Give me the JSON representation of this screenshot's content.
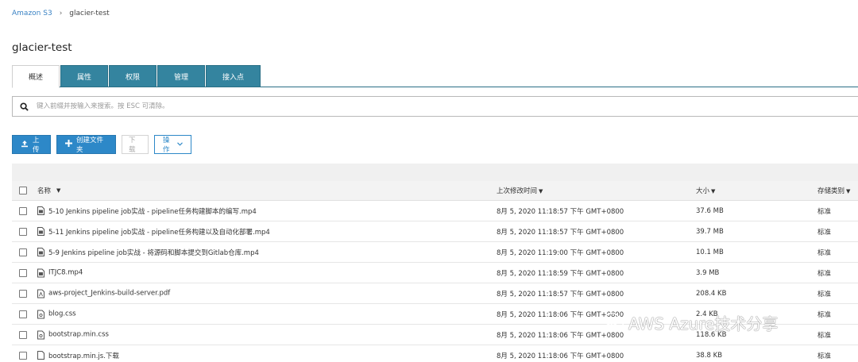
{
  "breadcrumb": {
    "root": "Amazon S3",
    "separator": "›",
    "current": "glacier-test"
  },
  "bucket": {
    "title": "glacier-test"
  },
  "tabs": [
    {
      "label": "概述",
      "active": true
    },
    {
      "label": "属性",
      "active": false
    },
    {
      "label": "权限",
      "active": false
    },
    {
      "label": "管理",
      "active": false
    },
    {
      "label": "接入点",
      "active": false
    }
  ],
  "search": {
    "placeholder": "键入前缀并按输入来搜索。按 ESC 可清除。",
    "value": ""
  },
  "toolbar": {
    "upload_label": "上传",
    "create_folder_label": "创建文件夹",
    "download_label": "下载",
    "actions_label": "操作"
  },
  "table": {
    "headers": {
      "name": "名称",
      "modified": "上次修改时间",
      "size": "大小",
      "storage_class": "存储类别"
    },
    "rows": [
      {
        "name": "5-10 Jenkins pipeline job实战 - pipeline任务构建脚本的编写.mp4",
        "icon": "video-file-icon",
        "modified": "8月 5, 2020 11:18:57 下午 GMT+0800",
        "size": "37.6 MB",
        "storage_class": "标准"
      },
      {
        "name": "5-11 Jenkins pipeline job实战 - pipeline任务构建以及自动化部署.mp4",
        "icon": "video-file-icon",
        "modified": "8月 5, 2020 11:18:57 下午 GMT+0800",
        "size": "39.7 MB",
        "storage_class": "标准"
      },
      {
        "name": "5-9 Jenkins pipeline job实战 - 将源码和脚本提交到Gitlab仓库.mp4",
        "icon": "video-file-icon",
        "modified": "8月 5, 2020 11:19:00 下午 GMT+0800",
        "size": "10.1 MB",
        "storage_class": "标准"
      },
      {
        "name": "ITJC8.mp4",
        "icon": "video-file-icon",
        "modified": "8月 5, 2020 11:18:59 下午 GMT+0800",
        "size": "3.9 MB",
        "storage_class": "标准"
      },
      {
        "name": "aws-project_Jenkins-build-server.pdf",
        "icon": "pdf-file-icon",
        "modified": "8月 5, 2020 11:18:57 下午 GMT+0800",
        "size": "208.4 KB",
        "storage_class": "标准"
      },
      {
        "name": "blog.css",
        "icon": "code-file-icon",
        "modified": "8月 5, 2020 11:18:06 下午 GMT+0800",
        "size": "2.4 KB",
        "storage_class": "标准"
      },
      {
        "name": "bootstrap.min.css",
        "icon": "code-file-icon",
        "modified": "8月 5, 2020 11:18:06 下午 GMT+0800",
        "size": "118.6 KB",
        "storage_class": "标准"
      },
      {
        "name": "bootstrap.min.js.下载",
        "icon": "blank-file-icon",
        "modified": "8月 5, 2020 11:18:06 下午 GMT+0800",
        "size": "38.8 KB",
        "storage_class": "标准"
      }
    ]
  },
  "watermark": {
    "text": "AWS Azure技术分享"
  }
}
